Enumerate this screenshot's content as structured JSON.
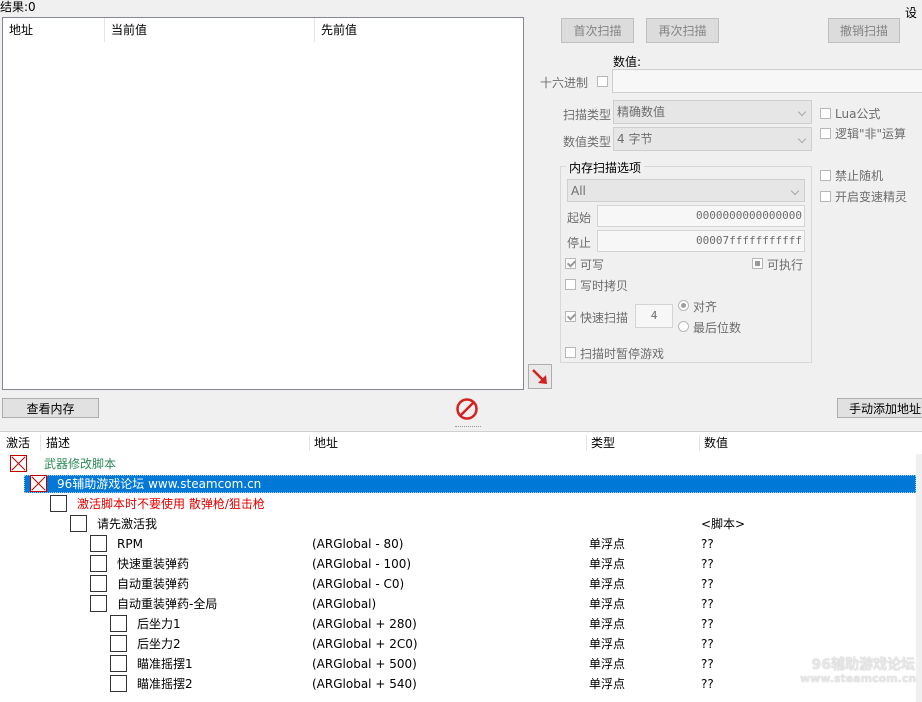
{
  "header": {
    "results_label": "结果:0",
    "corner_label": "设"
  },
  "scan_list": {
    "columns": [
      "地址",
      "当前值",
      "先前值"
    ]
  },
  "buttons": {
    "first_scan": "首次扫描",
    "next_scan": "再次扫描",
    "undo_scan": "撤销扫描",
    "view_memory": "查看内存",
    "add_address": "手动添加地址"
  },
  "scan_options": {
    "value_label": "数值:",
    "hex_label": "十六进制",
    "scan_type_label": "扫描类型",
    "scan_type_value": "精确数值",
    "value_type_label": "数值类型",
    "value_type_value": "4 字节",
    "lua_label": "Lua公式",
    "not_label": "逻辑\"非\"运算",
    "memory_group_title": "内存扫描选项",
    "region_value": "All",
    "start_label": "起始",
    "start_value": "0000000000000000",
    "stop_label": "停止",
    "stop_value": "00007fffffffffff",
    "writable_label": "可写",
    "executable_label": "可执行",
    "cow_label": "写时拷贝",
    "fast_scan_label": "快速扫描",
    "fast_scan_value": "4",
    "align_label": "对齐",
    "last_digits_label": "最后位数",
    "pause_label": "扫描时暂停游戏",
    "no_random_label": "禁止随机",
    "speedhack_label": "开启变速精灵"
  },
  "cheat_table": {
    "columns": {
      "active": "激活",
      "desc": "描述",
      "address": "地址",
      "type": "类型",
      "value": "数值"
    },
    "rows": [
      {
        "desc": "武器修改脚本",
        "address": "",
        "type": "",
        "value": "",
        "indent": 0,
        "checked": true,
        "color": "#2e8b57",
        "selected": false
      },
      {
        "desc": "96辅助游戏论坛 www.steamcom.cn",
        "address": "",
        "type": "",
        "value": "",
        "indent": 1,
        "checked": true,
        "color": "#ffffff",
        "selected": true
      },
      {
        "desc": "激活脚本时不要使用 散弹枪/狙击枪",
        "address": "",
        "type": "",
        "value": "",
        "indent": 2,
        "checked": false,
        "color": "#e00000",
        "selected": false
      },
      {
        "desc": "请先激活我",
        "address": "",
        "type": "",
        "value": "<脚本>",
        "indent": 3,
        "checked": false,
        "color": "#000000",
        "selected": false
      },
      {
        "desc": "RPM",
        "address": "(ARGlobal - 80)",
        "type": "单浮点",
        "value": "??",
        "indent": 4,
        "checked": false,
        "color": "#000000",
        "selected": false
      },
      {
        "desc": "快速重装弹药",
        "address": "(ARGlobal - 100)",
        "type": "单浮点",
        "value": "??",
        "indent": 4,
        "checked": false,
        "color": "#000000",
        "selected": false
      },
      {
        "desc": "自动重装弹药",
        "address": "(ARGlobal - C0)",
        "type": "单浮点",
        "value": "??",
        "indent": 4,
        "checked": false,
        "color": "#000000",
        "selected": false
      },
      {
        "desc": "自动重装弹药-全局",
        "address": "(ARGlobal)",
        "type": "单浮点",
        "value": "??",
        "indent": 4,
        "checked": false,
        "color": "#000000",
        "selected": false
      },
      {
        "desc": "后坐力1",
        "address": "(ARGlobal + 280)",
        "type": "单浮点",
        "value": "??",
        "indent": 5,
        "checked": false,
        "color": "#000000",
        "selected": false
      },
      {
        "desc": "后坐力2",
        "address": "(ARGlobal + 2C0)",
        "type": "单浮点",
        "value": "??",
        "indent": 5,
        "checked": false,
        "color": "#000000",
        "selected": false
      },
      {
        "desc": "瞄准摇摆1",
        "address": "(ARGlobal + 500)",
        "type": "单浮点",
        "value": "??",
        "indent": 5,
        "checked": false,
        "color": "#000000",
        "selected": false
      },
      {
        "desc": "瞄准摇摆2",
        "address": "(ARGlobal + 540)",
        "type": "单浮点",
        "value": "??",
        "indent": 5,
        "checked": false,
        "color": "#000000",
        "selected": false
      }
    ]
  },
  "watermark": {
    "line1": "96辅助游戏论坛",
    "line2": "www.steamcom.cn"
  },
  "colors": {
    "selection": "#0078d7",
    "accent_arrow": "#d42020"
  }
}
